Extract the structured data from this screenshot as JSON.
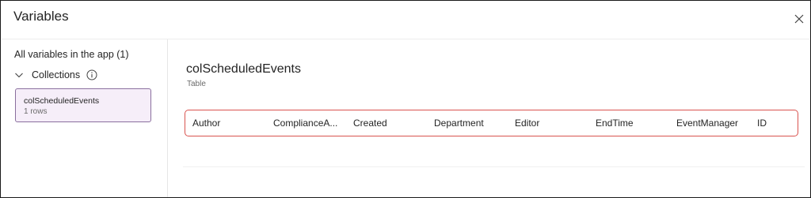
{
  "dialog": {
    "title": "Variables"
  },
  "sidebar": {
    "heading": "All variables in the app (1)",
    "section_label": "Collections",
    "items": [
      {
        "name": "colScheduledEvents",
        "rows": "1 rows"
      }
    ]
  },
  "main": {
    "variable_name": "colScheduledEvents",
    "variable_type": "Table",
    "columns": [
      "Author",
      "ComplianceA...",
      "Created",
      "Department",
      "Editor",
      "EndTime",
      "EventManager",
      "ID"
    ]
  },
  "icons": {
    "close": "close-icon",
    "chevron": "chevron-down-icon",
    "info": "info-icon"
  },
  "colors": {
    "selected_bg": "#f6eef9",
    "selected_border": "#8a6f9e",
    "highlight_border": "#d9534f"
  }
}
